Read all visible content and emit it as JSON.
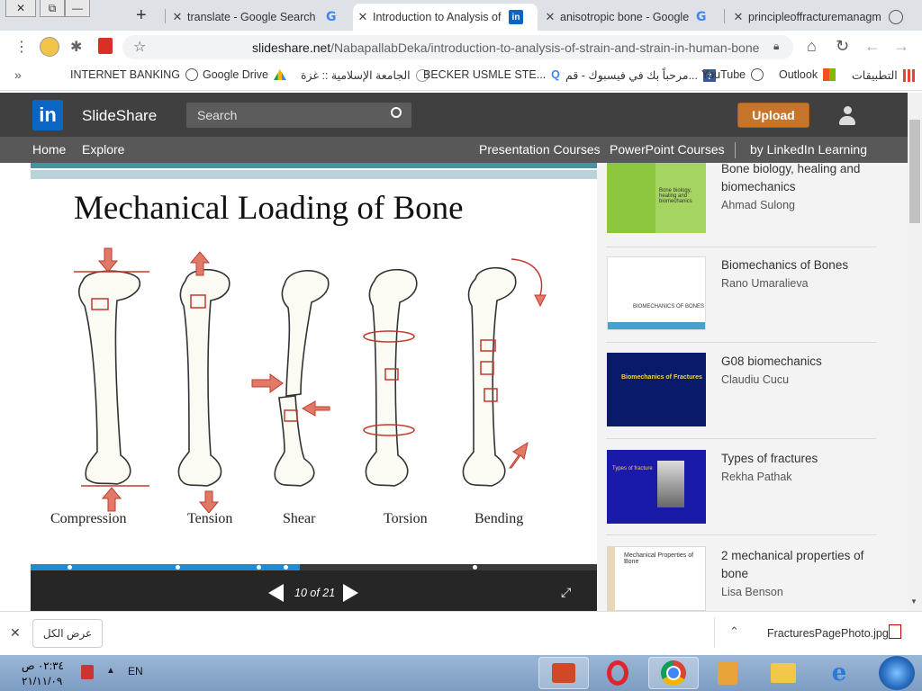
{
  "browser": {
    "tabs": [
      {
        "title": "translate - Google Search",
        "icon": "google-icon",
        "active": false
      },
      {
        "title": "Introduction to Analysis of",
        "icon": "linkedin-icon",
        "active": true
      },
      {
        "title": "anisotropic bone - Google",
        "icon": "google-icon",
        "active": false
      },
      {
        "title": "principleoffracturemanagm",
        "icon": "globe-icon",
        "active": false
      }
    ],
    "new_tab_label": "+",
    "url_host": "slideshare.net",
    "url_path": "/NabapallabDeka/introduction-to-analysis-of-strain-and-strain-in-human-bone",
    "bookmarks": [
      {
        "label": "INTERNET BANKING",
        "icon": "globe-icon"
      },
      {
        "label": "Google Drive",
        "icon": "drive-icon"
      },
      {
        "label": "الجامعة الإسلامية :: غزة",
        "icon": "university-icon"
      },
      {
        "label": "BECKER USMLE STE...",
        "icon": "search-icon"
      },
      {
        "label": "مرحباً بك في فيسبوك - قم...",
        "icon": "facebook-icon"
      },
      {
        "label": "YouTube",
        "icon": "globe-icon"
      },
      {
        "label": "Outlook",
        "icon": "globe-icon"
      },
      {
        "label": "التطبيقات",
        "icon": "apps-grid-icon"
      }
    ],
    "more_bookmarks": "»"
  },
  "slideshare": {
    "logo_text": "SlideShare",
    "logo_badge": "in",
    "search_placeholder": "Search",
    "upload_label": "Upload",
    "nav_left": [
      "Home",
      "Explore"
    ],
    "nav_right": [
      "Presentation Courses",
      "PowerPoint Courses",
      "by LinkedIn Learning"
    ],
    "slide": {
      "title": "Mechanical Loading of Bone",
      "labels": [
        "Compression",
        "Tension",
        "Shear",
        "Torsion",
        "Bending"
      ]
    },
    "player": {
      "counter": "10 of 21",
      "progress": 0.476
    },
    "related": [
      {
        "title": "Bone biology, healing and biomechanics",
        "author": "Ahmad Sulong",
        "thumb_text": "Bone biology, healing and biomechanics",
        "thumb_color": "#8cc63f"
      },
      {
        "title": "Biomechanics of Bones",
        "author": "Rano Umaralieva",
        "thumb_text": "BIOMECHANICS OF BONES",
        "thumb_color": "#ffffff"
      },
      {
        "title": "G08 biomechanics",
        "author": "Claudiu Cucu",
        "thumb_text": "Biomechanics of Fractures",
        "thumb_color": "#0a1a6b"
      },
      {
        "title": "Types of fractures",
        "author": "Rekha Pathak",
        "thumb_text": "Types of fracture",
        "thumb_color": "#1a1aa8"
      },
      {
        "title": "2 mechanical properties of bone",
        "author": "Lisa Benson",
        "thumb_text": "Mechanical Properties of Bone",
        "thumb_color": "#ffffff"
      }
    ]
  },
  "downloads": {
    "show_all_label": "عرض الكل",
    "file_name": "FracturesPagePhoto.jpg",
    "close_label": "✕"
  },
  "taskbar": {
    "time": "٠٢:٣٤ ص",
    "date": "٢١/١١/٠٩",
    "language": "EN"
  }
}
